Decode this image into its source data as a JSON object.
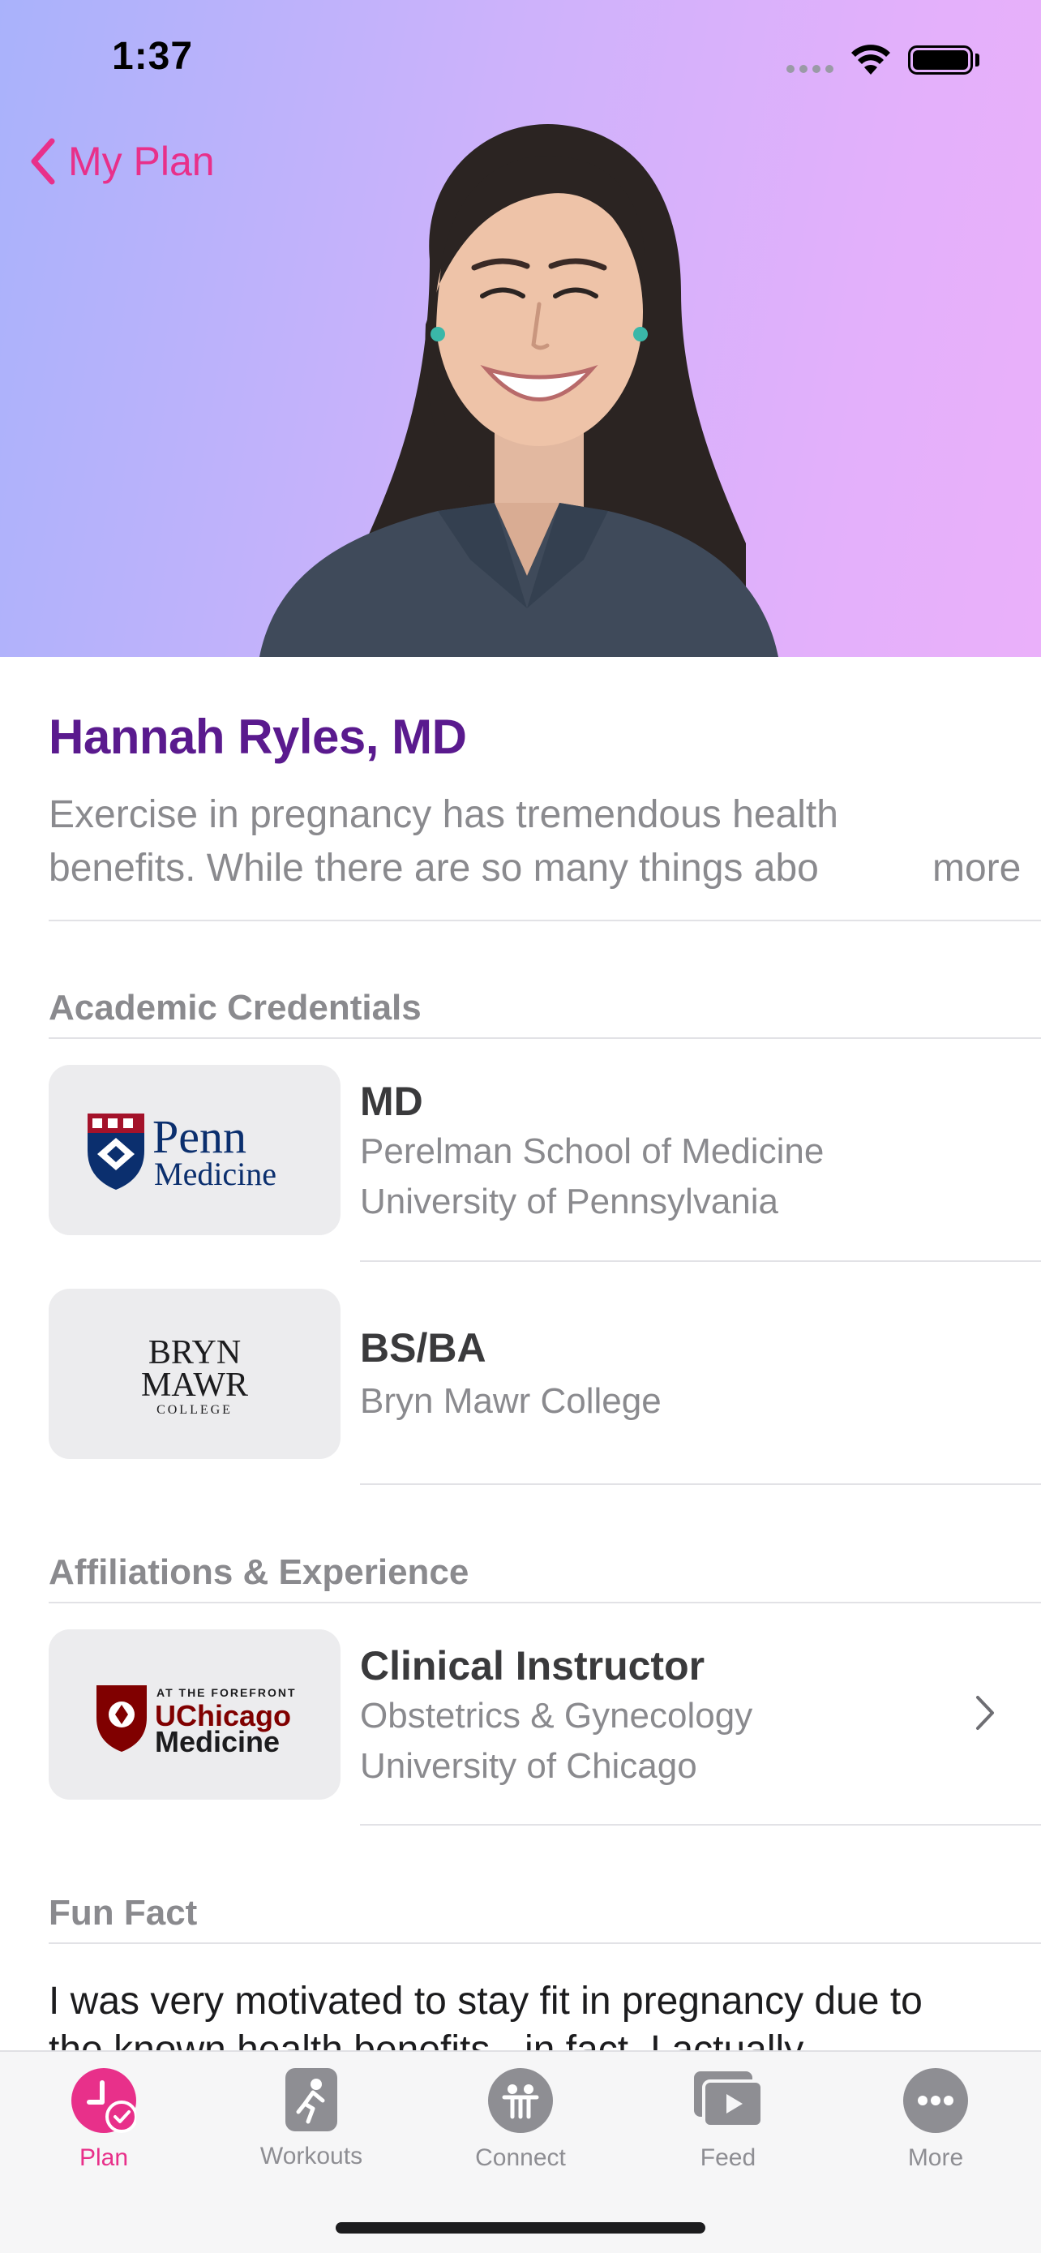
{
  "status_bar": {
    "time": "1:37"
  },
  "nav": {
    "back_label": "My Plan"
  },
  "profile": {
    "name": "Hannah Ryles, MD",
    "bio_line1": "Exercise in pregnancy has tremendous health",
    "bio_line2": "benefits. While there are so many things abo",
    "more_label": "more"
  },
  "academic": {
    "title": "Academic Credentials",
    "items": [
      {
        "logo": "Penn Medicine",
        "degree": "MD",
        "line1": "Perelman School of Medicine",
        "line2": "University of Pennsylvania"
      },
      {
        "logo": "BRYN MAWR COLLEGE",
        "degree": "BS/BA",
        "line1": "Bryn Mawr College"
      }
    ]
  },
  "affiliations": {
    "title": "Affiliations & Experience",
    "items": [
      {
        "logo": "AT THE FOREFRONT UChicago Medicine",
        "role": "Clinical Instructor",
        "line1": "Obstetrics & Gynecology",
        "line2": "University of Chicago"
      }
    ]
  },
  "fun_fact": {
    "title": "Fun Fact",
    "text_line1": "I was very motivated to stay fit in pregnancy due to",
    "text_line2": "the known health benefits - in fact, I actually"
  },
  "tabs": [
    {
      "label": "Plan",
      "icon": "plan-icon",
      "active": true
    },
    {
      "label": "Workouts",
      "icon": "workouts-icon",
      "active": false
    },
    {
      "label": "Connect",
      "icon": "connect-icon",
      "active": false
    },
    {
      "label": "Feed",
      "icon": "feed-icon",
      "active": false
    },
    {
      "label": "More",
      "icon": "more-icon",
      "active": false
    }
  ],
  "colors": {
    "accent": "#e8308a",
    "name": "#5a1a8e",
    "secondary": "#8a8a8e"
  },
  "logos": {
    "penn_word1": "Penn",
    "penn_word2": "Medicine",
    "bryn1": "BRYN",
    "bryn2": "MAWR",
    "bryn3": "COLLEGE",
    "uc_small": "AT THE FOREFRONT",
    "uc_big1": "UChicago",
    "uc_big2": "Medicine"
  }
}
